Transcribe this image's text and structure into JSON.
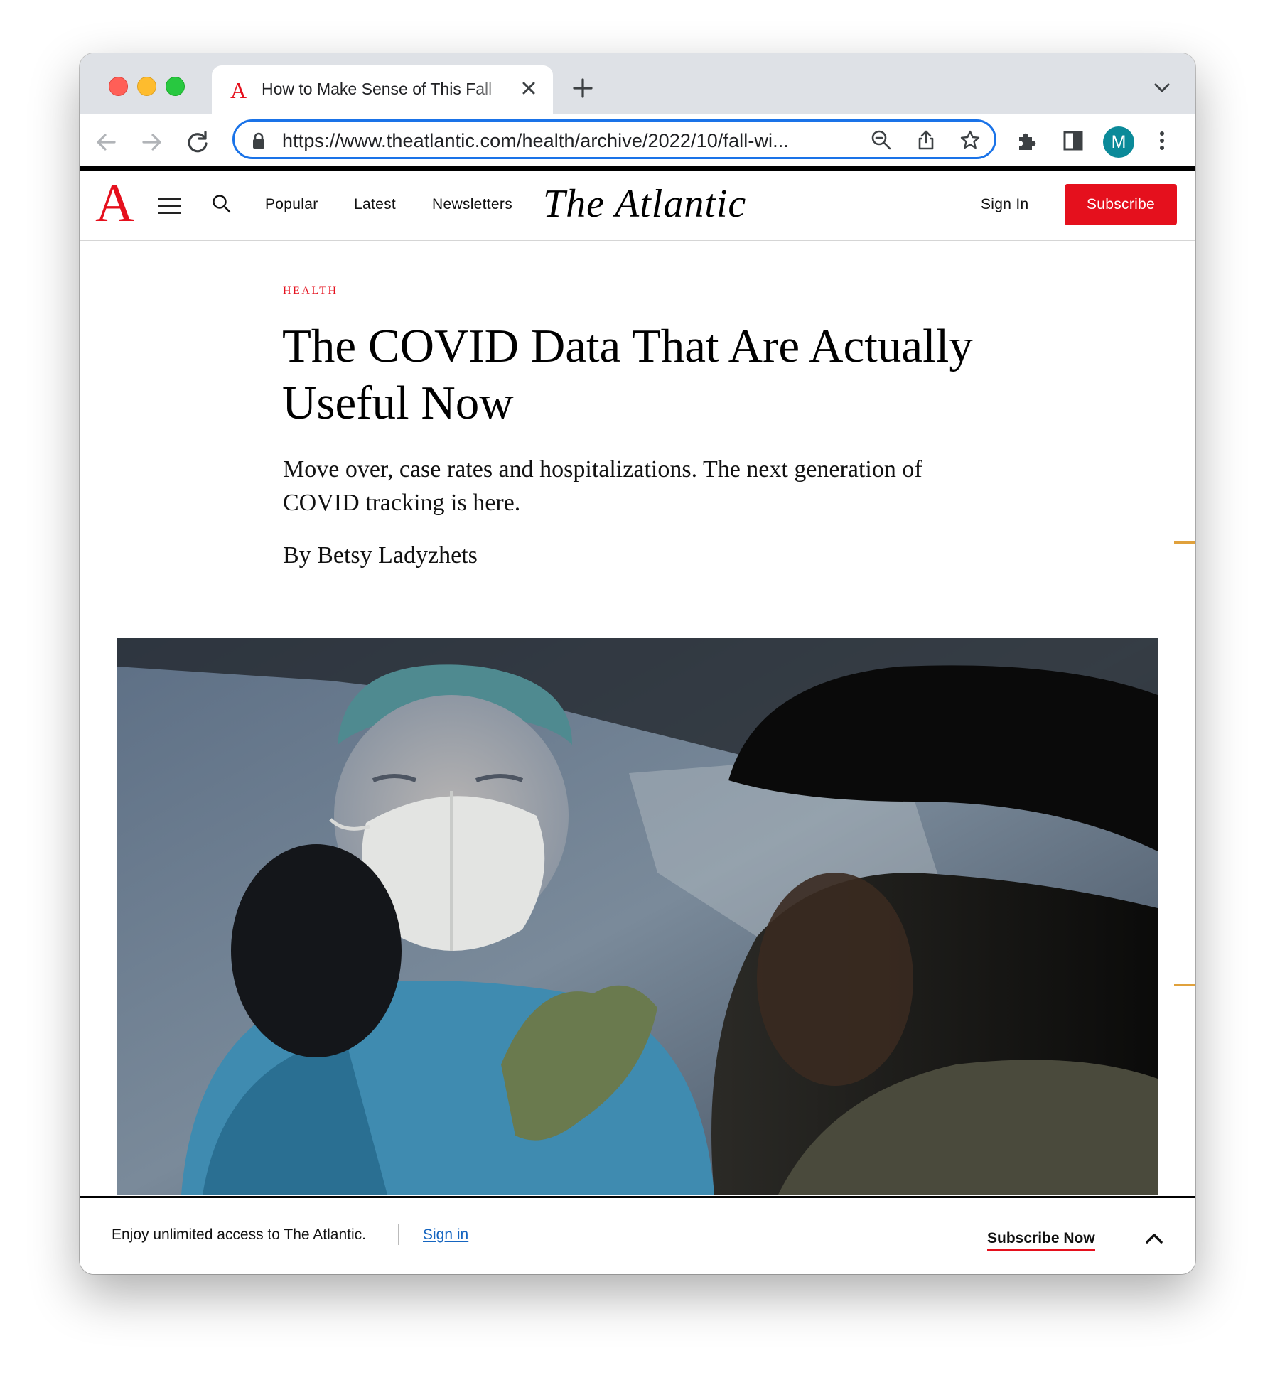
{
  "browser": {
    "tab_title": "How to Make Sense of This Fall",
    "tab_favicon_letter": "A",
    "url": "https://www.theatlantic.com/health/archive/2022/10/fall-wi...",
    "profile_initial": "M"
  },
  "site": {
    "logo_letter": "A",
    "nav": [
      "Popular",
      "Latest",
      "Newsletters"
    ],
    "wordmark": "The Atlantic",
    "sign_in": "Sign In",
    "subscribe": "Subscribe"
  },
  "article": {
    "section": "HEALTH",
    "headline": "The COVID Data That Are Actually Useful Now",
    "dek": "Move over, case rates and hospitalizations. The next generation of COVID tracking is here.",
    "byline": "By Betsy Ladyzhets"
  },
  "banner": {
    "text": "Enjoy unlimited access to The Atlantic.",
    "sign_in": "Sign in",
    "subscribe": "Subscribe Now"
  },
  "colors": {
    "accent_red": "#e5101d",
    "omnibox_blue": "#1a73e8",
    "avatar_teal": "#0b8a99"
  }
}
